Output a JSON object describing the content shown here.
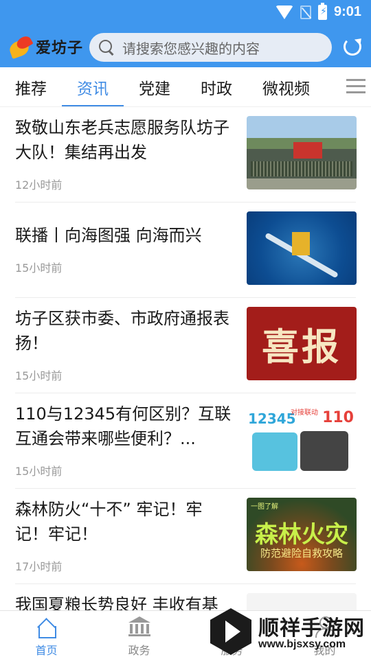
{
  "status_bar": {
    "time": "9:01"
  },
  "header": {
    "app_name": "爱坊子",
    "search_placeholder": "请搜索您感兴趣的内容"
  },
  "tabs": [
    {
      "label": "推荐",
      "active": false
    },
    {
      "label": "资讯",
      "active": true
    },
    {
      "label": "党建",
      "active": false
    },
    {
      "label": "时政",
      "active": false
    },
    {
      "label": "微视频",
      "active": false
    }
  ],
  "news": [
    {
      "title": "致敬山东老兵志愿服务队坊子大队！集结再出发",
      "time": "12小时前"
    },
    {
      "title": "联播丨向海图强 向海而兴",
      "time": "15小时前"
    },
    {
      "title": "坊子区获市委、市政府通报表扬！",
      "time": "15小时前",
      "thumb_text": "喜报"
    },
    {
      "title": "110与12345有何区别？互联互通会带来哪些便利？...",
      "time": "15小时前",
      "thumb_text_a": "12345",
      "thumb_text_b": "110",
      "thumb_tag": "对接联动"
    },
    {
      "title": "森林防火“十不” 牢记！牢记！牢记！",
      "time": "17小时前",
      "thumb_top": "一图了解",
      "thumb_big": "森林火灾",
      "thumb_small": "防范避险自救攻略"
    },
    {
      "title": "我国夏粮长势良好 丰收有基",
      "time": ""
    }
  ],
  "bottom_nav": [
    {
      "label": "首页",
      "icon": "home-icon",
      "active": true
    },
    {
      "label": "政务",
      "icon": "government-icon",
      "active": false
    },
    {
      "label": "服务",
      "icon": "service-icon",
      "active": false
    },
    {
      "label": "我的",
      "icon": "profile-icon",
      "active": false
    }
  ],
  "watermark": {
    "name": "顺祥手游网",
    "url": "www.bjsxsy.com"
  },
  "colors": {
    "primary": "#3f97ee",
    "accent": "#3f8be4",
    "muted": "#999999"
  }
}
